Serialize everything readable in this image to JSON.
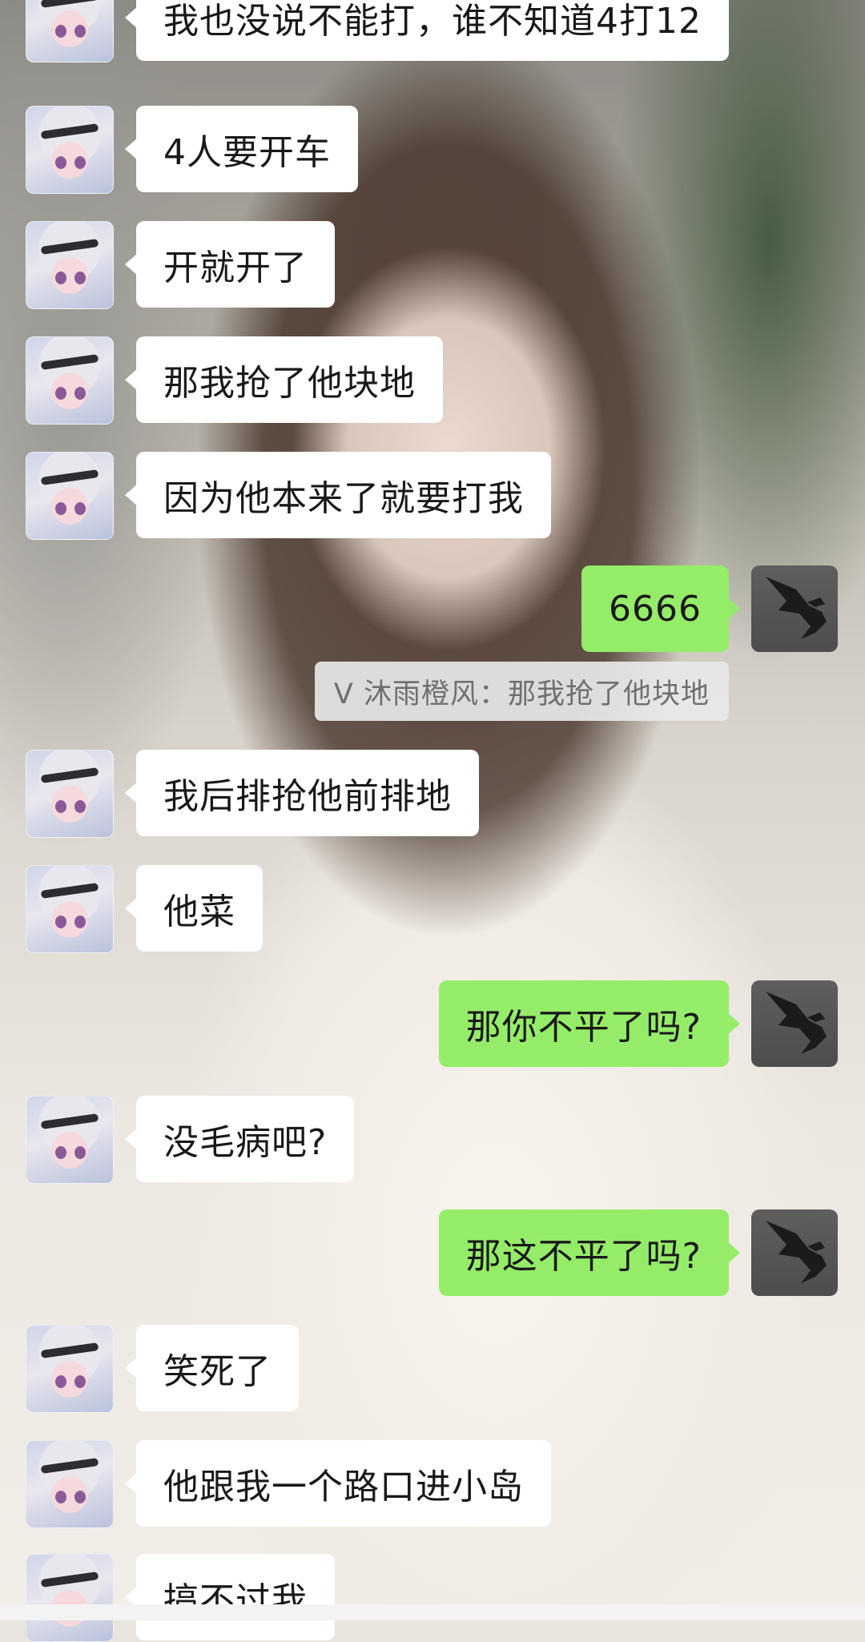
{
  "messages": [
    {
      "side": "in",
      "text": "我也没说不能打，谁不知道4打12"
    },
    {
      "side": "in",
      "text": "4人要开车"
    },
    {
      "side": "in",
      "text": "开就开了"
    },
    {
      "side": "in",
      "text": "那我抢了他块地"
    },
    {
      "side": "in",
      "text": "因为他本来了就要打我"
    },
    {
      "side": "out",
      "text": "6666"
    },
    {
      "side": "quote",
      "text": "V 沐雨橙风：那我抢了他块地"
    },
    {
      "side": "in",
      "text": "我后排抢他前排地"
    },
    {
      "side": "in",
      "text": "他菜"
    },
    {
      "side": "out",
      "text": "那你不平了吗?"
    },
    {
      "side": "in",
      "text": "没毛病吧?"
    },
    {
      "side": "out",
      "text": "那这不平了吗?"
    },
    {
      "side": "in",
      "text": "笑死了"
    },
    {
      "side": "in",
      "text": "他跟我一个路口进小岛"
    },
    {
      "side": "in",
      "text": "搞不过我"
    }
  ],
  "colors": {
    "incoming_bubble": "#ffffff",
    "outgoing_bubble": "#95ec69",
    "quote_bg": "#e8e8e8",
    "text": "#191919",
    "quote_text": "#6f6f6f"
  },
  "avatars": {
    "incoming": "anime-girl-avatar",
    "outgoing": "eagle-avatar"
  }
}
